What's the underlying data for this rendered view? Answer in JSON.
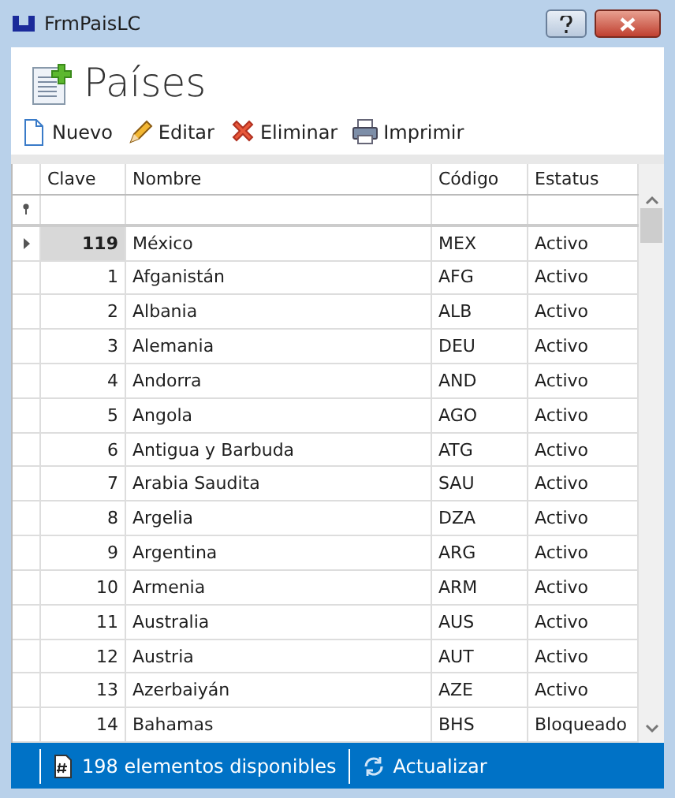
{
  "window": {
    "title": "FrmPaisLC"
  },
  "header": {
    "title": "Países"
  },
  "toolbar": [
    {
      "kind": "new",
      "label": "Nuevo"
    },
    {
      "kind": "edit",
      "label": "Editar"
    },
    {
      "kind": "delete",
      "label": "Eliminar"
    },
    {
      "kind": "print",
      "label": "Imprimir"
    }
  ],
  "table": {
    "columns": [
      "Clave",
      "Nombre",
      "Código",
      "Estatus"
    ],
    "rows": [
      {
        "clave": "119",
        "nombre": "México",
        "codigo": "MEX",
        "estatus": "Activo",
        "selected": true
      },
      {
        "clave": "1",
        "nombre": "Afganistán",
        "codigo": "AFG",
        "estatus": "Activo",
        "selected": false
      },
      {
        "clave": "2",
        "nombre": "Albania",
        "codigo": "ALB",
        "estatus": "Activo",
        "selected": false
      },
      {
        "clave": "3",
        "nombre": "Alemania",
        "codigo": "DEU",
        "estatus": "Activo",
        "selected": false
      },
      {
        "clave": "4",
        "nombre": "Andorra",
        "codigo": "AND",
        "estatus": "Activo",
        "selected": false
      },
      {
        "clave": "5",
        "nombre": "Angola",
        "codigo": "AGO",
        "estatus": "Activo",
        "selected": false
      },
      {
        "clave": "6",
        "nombre": "Antigua y Barbuda",
        "codigo": "ATG",
        "estatus": "Activo",
        "selected": false
      },
      {
        "clave": "7",
        "nombre": "Arabia Saudita",
        "codigo": "SAU",
        "estatus": "Activo",
        "selected": false
      },
      {
        "clave": "8",
        "nombre": "Argelia",
        "codigo": "DZA",
        "estatus": "Activo",
        "selected": false
      },
      {
        "clave": "9",
        "nombre": "Argentina",
        "codigo": "ARG",
        "estatus": "Activo",
        "selected": false
      },
      {
        "clave": "10",
        "nombre": "Armenia",
        "codigo": "ARM",
        "estatus": "Activo",
        "selected": false
      },
      {
        "clave": "11",
        "nombre": "Australia",
        "codigo": "AUS",
        "estatus": "Activo",
        "selected": false
      },
      {
        "clave": "12",
        "nombre": "Austria",
        "codigo": "AUT",
        "estatus": "Activo",
        "selected": false
      },
      {
        "clave": "13",
        "nombre": "Azerbaiyán",
        "codigo": "AZE",
        "estatus": "Activo",
        "selected": false
      },
      {
        "clave": "14",
        "nombre": "Bahamas",
        "codigo": "BHS",
        "estatus": "Bloqueado",
        "selected": false
      }
    ]
  },
  "status_bar": {
    "count": "198 elementos disponibles",
    "refresh": "Actualizar"
  }
}
